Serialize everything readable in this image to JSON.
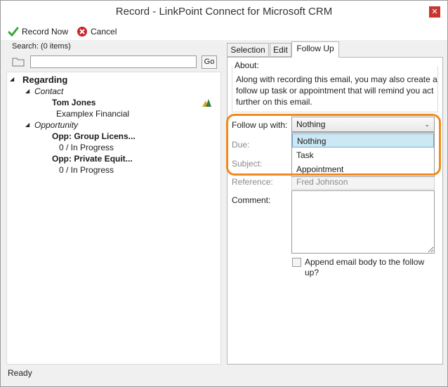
{
  "window": {
    "title": "Record - LinkPoint Connect for Microsoft CRM",
    "close_label": "✕"
  },
  "toolbar": {
    "record_now": "Record Now",
    "cancel": "Cancel"
  },
  "search": {
    "label": "Search: (0 items)",
    "value": "",
    "go": "Go"
  },
  "tree": {
    "root": "Regarding",
    "contact_label": "Contact",
    "contact_name": "Tom Jones",
    "contact_company": "Examplex Financial",
    "opportunity_label": "Opportunity",
    "opp1_name": "Opp: Group Licens...",
    "opp1_status": "0 / In Progress",
    "opp2_name": "Opp: Private Equit...",
    "opp2_status": "0 / In Progress"
  },
  "tabs": [
    "Selection",
    "Edit",
    "Follow Up"
  ],
  "follow_up": {
    "about_label": "About:",
    "about_text": "Along with recording this email, you may also create a follow up task or appointment that will remind you act further on this email.",
    "follow_up_with_label": "Follow up with:",
    "follow_up_value": "Nothing",
    "options": [
      "Nothing",
      "Task",
      "Appointment"
    ],
    "due_label": "Due:",
    "subject_label": "Subject:",
    "reference_label": "Reference:",
    "reference_value": "Fred Johnson",
    "comment_label": "Comment:",
    "append_label": "Append email body to the follow up?"
  },
  "status": "Ready",
  "colors": {
    "highlight": "#f08a1c",
    "close": "#c7372f",
    "selected_option": "#cce8f4"
  }
}
